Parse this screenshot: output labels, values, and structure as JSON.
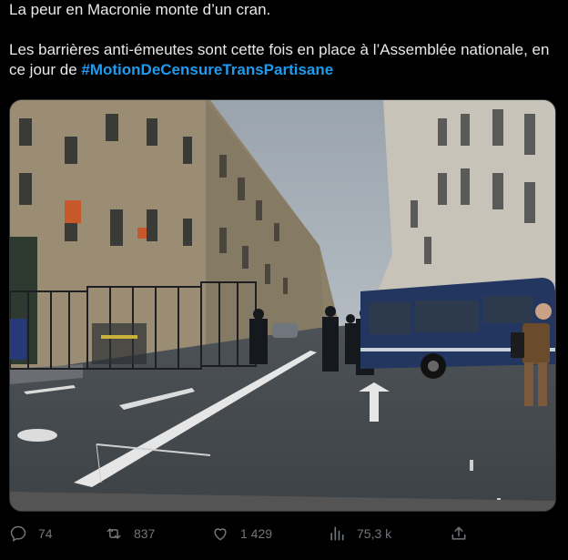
{
  "tweet": {
    "line1": "La peur en Macronie monte d’un cran.",
    "line2_prefix": "Les barrières anti-émeutes sont cette fois en place à l’Assemblée nationale, en ce jour de ",
    "hashtag": "#MotionDeCensureTransPartisane"
  },
  "media": {
    "alt_icon": "photo"
  },
  "actions": {
    "replies": "74",
    "reposts": "837",
    "likes": "1 429",
    "views": "75,3 k",
    "reply_icon": "reply-icon",
    "repost_icon": "repost-icon",
    "like_icon": "heart-icon",
    "views_icon": "views-chart-icon",
    "share_icon": "share-icon"
  },
  "colors": {
    "background": "#000000",
    "text": "#e7e9ea",
    "link": "#1d9bf0",
    "muted": "#71767b"
  }
}
